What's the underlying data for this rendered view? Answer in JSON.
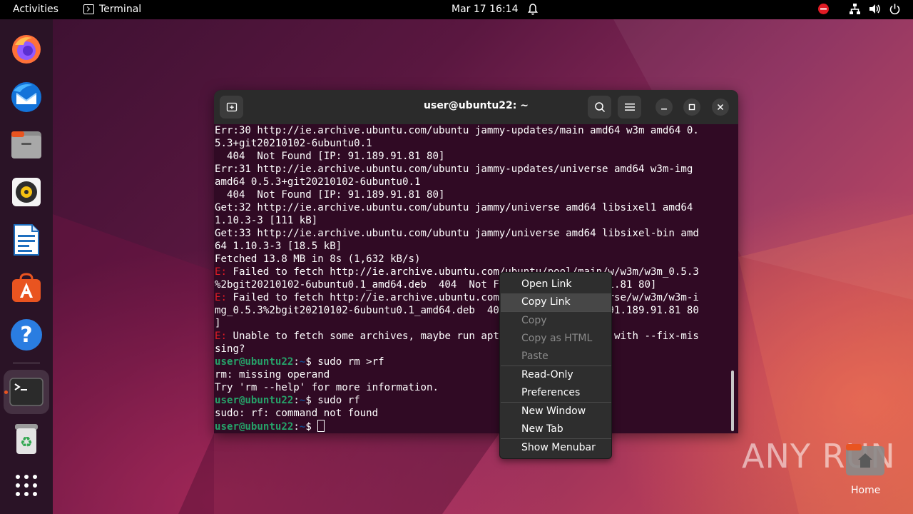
{
  "topbar": {
    "activities": "Activities",
    "app_name": "Terminal",
    "clock": "Mar 17  16:14"
  },
  "dock": {
    "items": [
      "firefox-icon",
      "thunderbird-icon",
      "files-icon",
      "rhythmbox-icon",
      "writer-icon",
      "app-center-icon",
      "help-icon",
      "terminal-icon",
      "trash-icon",
      "show-apps-icon"
    ]
  },
  "terminal": {
    "title": "user@ubuntu22: ~",
    "lines": [
      {
        "t": "plain",
        "text": "Err:30 http://ie.archive.ubuntu.com/ubuntu jammy-updates/main amd64 w3m amd64 0."
      },
      {
        "t": "plain",
        "text": "5.3+git20210102-6ubuntu0.1"
      },
      {
        "t": "plain",
        "text": "  404  Not Found [IP: 91.189.91.81 80]"
      },
      {
        "t": "plain",
        "text": "Err:31 http://ie.archive.ubuntu.com/ubuntu jammy-updates/universe amd64 w3m-img"
      },
      {
        "t": "plain",
        "text": "amd64 0.5.3+git20210102-6ubuntu0.1"
      },
      {
        "t": "plain",
        "text": "  404  Not Found [IP: 91.189.91.81 80]"
      },
      {
        "t": "plain",
        "text": "Get:32 http://ie.archive.ubuntu.com/ubuntu jammy/universe amd64 libsixel1 amd64"
      },
      {
        "t": "plain",
        "text": "1.10.3-3 [111 kB]"
      },
      {
        "t": "plain",
        "text": "Get:33 http://ie.archive.ubuntu.com/ubuntu jammy/universe amd64 libsixel-bin amd"
      },
      {
        "t": "plain",
        "text": "64 1.10.3-3 [18.5 kB]"
      },
      {
        "t": "plain",
        "text": "Fetched 13.8 MB in 8s (1,632 kB/s)"
      },
      {
        "t": "err",
        "prefix": "E:",
        "text": " Failed to fetch http://ie.archive.ubuntu.com/ubuntu/pool/main/w/w3m/w3m_0.5.3"
      },
      {
        "t": "plain",
        "text": "%2bgit20210102-6ubuntu0.1_amd64.deb  404  Not Found [IP: 91.189.91.81 80]"
      },
      {
        "t": "err",
        "prefix": "E:",
        "text": " Failed to fetch http://ie.archive.ubuntu.com/ubuntu/pool/universe/w/w3m/w3m-i"
      },
      {
        "t": "plain",
        "text": "mg_0.5.3%2bgit20210102-6ubuntu0.1_amd64.deb  404  Not Found [IP: 91.189.91.81 80"
      },
      {
        "t": "plain",
        "text": "]"
      },
      {
        "t": "err",
        "prefix": "E:",
        "text": " Unable to fetch some archives, maybe run apt-get update or try with --fix-mis"
      },
      {
        "t": "plain",
        "text": "sing?"
      },
      {
        "t": "prompt",
        "user": "user@ubuntu22",
        "sep": ":",
        "path": "~",
        "cmd": "$ sudo rm >rf"
      },
      {
        "t": "plain",
        "text": "rm: missing operand"
      },
      {
        "t": "plain",
        "text": "Try 'rm --help' for more information."
      },
      {
        "t": "prompt",
        "user": "user@ubuntu22",
        "sep": ":",
        "path": "~",
        "cmd": "$ sudo rf"
      },
      {
        "t": "plain",
        "text": "sudo: rf: command not found"
      },
      {
        "t": "prompt-cursor",
        "user": "user@ubuntu22",
        "sep": ":",
        "path": "~",
        "cmd": "$ "
      }
    ]
  },
  "context_menu": {
    "items": [
      {
        "label": "Open Link",
        "state": "normal"
      },
      {
        "label": "Copy Link",
        "state": "hover"
      },
      {
        "label": "Copy",
        "state": "disabled"
      },
      {
        "label": "Copy as HTML",
        "state": "disabled"
      },
      {
        "label": "Paste",
        "state": "disabled"
      },
      {
        "label": "Read-Only",
        "state": "normal"
      },
      {
        "label": "Preferences",
        "state": "normal"
      },
      {
        "label": "New Window",
        "state": "normal"
      },
      {
        "label": "New Tab",
        "state": "normal"
      },
      {
        "label": "Show Menubar",
        "state": "normal"
      }
    ]
  },
  "watermark": "ANY RUN",
  "home": {
    "label": "Home"
  }
}
